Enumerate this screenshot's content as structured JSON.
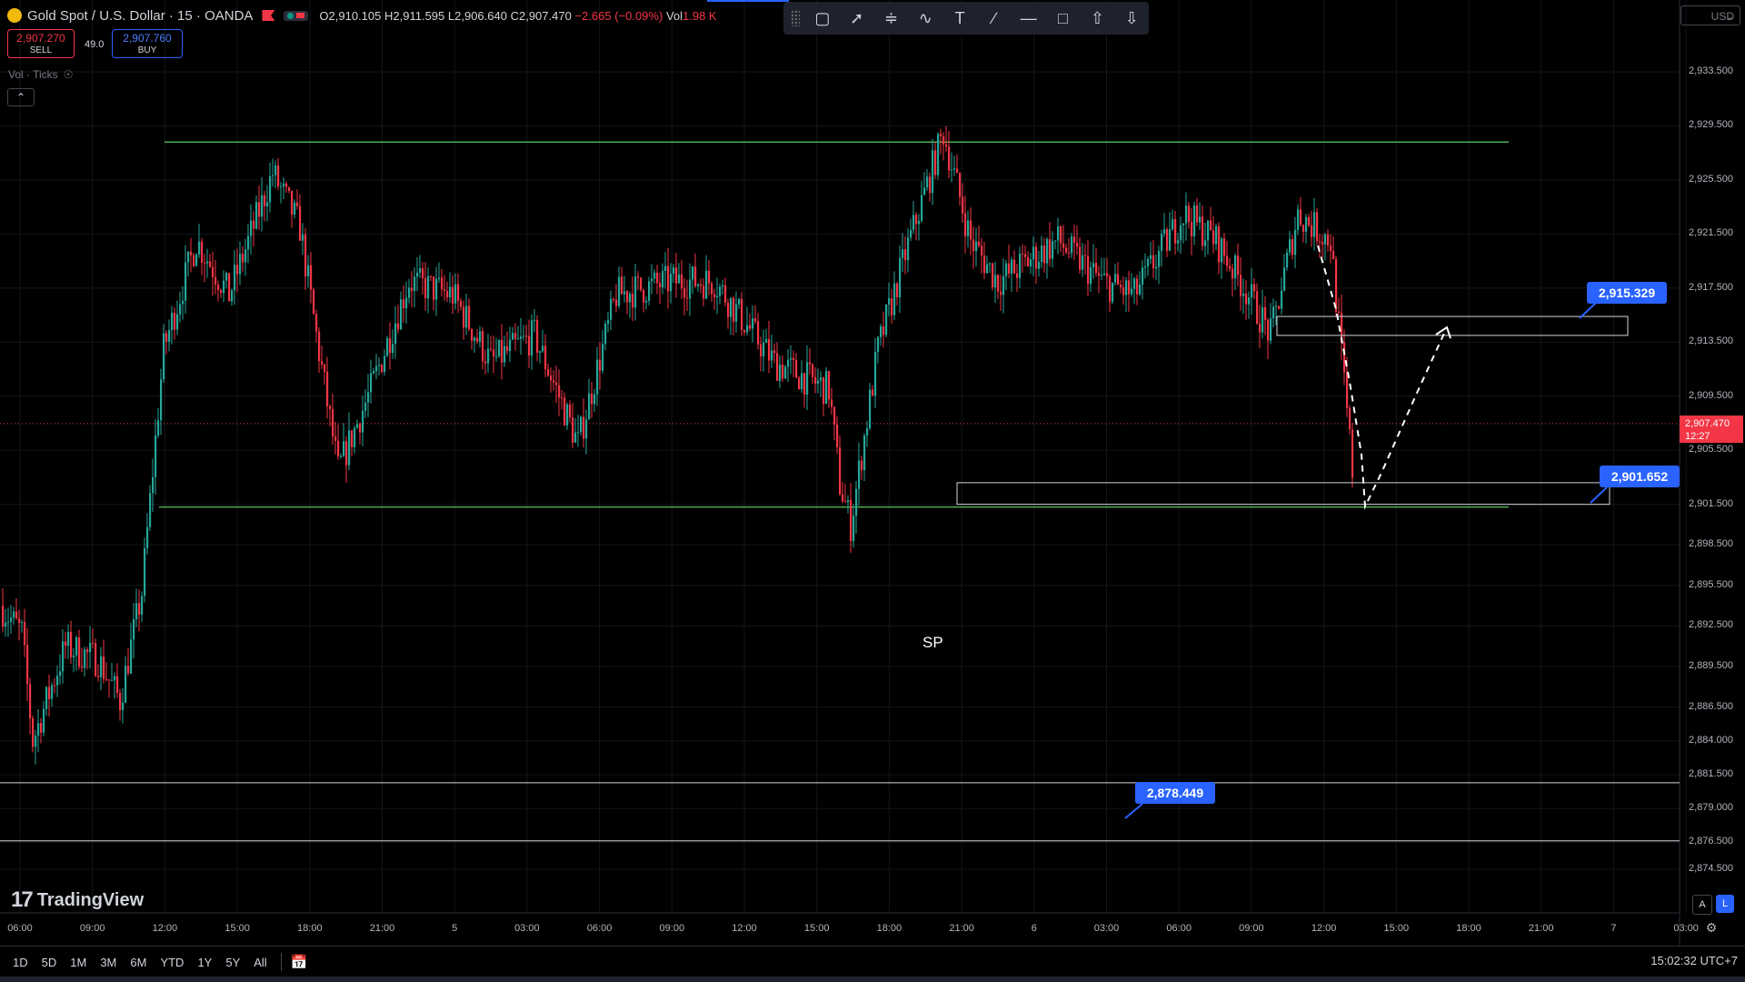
{
  "header": {
    "symbol": "Gold Spot / U.S. Dollar · 15 · OANDA",
    "open": "O2,910.105",
    "high": "H2,911.595",
    "low": "L2,906.640",
    "close": "C2,907.470",
    "change": "−2.665 (−0.09%)",
    "vol_label": "Vol",
    "vol_value": "1.98 K"
  },
  "trade": {
    "sell_price": "2,907.270",
    "sell_label": "SELL",
    "spread": "49.0",
    "buy_price": "2,907.760",
    "buy_label": "BUY"
  },
  "indicator": {
    "label": "Vol · Ticks"
  },
  "toolbar": {
    "tools": [
      "rectangle-icon",
      "trend-line-icon",
      "fib-icon",
      "path-icon",
      "text-icon",
      "ray-icon",
      "horizontal-line-icon",
      "callout-icon",
      "arrow-up-icon",
      "arrow-down-icon"
    ],
    "text_tool": "T"
  },
  "currency": {
    "label": "USD",
    "caret": "⌄"
  },
  "watermark": {
    "text": "TradingView",
    "mark": "17"
  },
  "annotations": {
    "sp": "SP",
    "levels": [
      "2,915.329",
      "2,901.652",
      "2,878.449"
    ]
  },
  "current_price": {
    "price": "2,907.470",
    "countdown": "12:27"
  },
  "price_axis": [
    "2,933.500",
    "2,929.500",
    "2,925.500",
    "2,921.500",
    "2,917.500",
    "2,913.500",
    "2,909.500",
    "2,905.500",
    "2,901.500",
    "2,898.500",
    "2,895.500",
    "2,892.500",
    "2,889.500",
    "2,886.500",
    "2,884.000",
    "2,881.500",
    "2,879.000",
    "2,876.500",
    "2,874.500"
  ],
  "time_axis": [
    "06:00",
    "09:00",
    "12:00",
    "15:00",
    "18:00",
    "21:00",
    "5",
    "03:00",
    "06:00",
    "09:00",
    "12:00",
    "15:00",
    "18:00",
    "21:00",
    "6",
    "03:00",
    "06:00",
    "09:00",
    "12:00",
    "15:00",
    "18:00",
    "21:00",
    "7",
    "03:00"
  ],
  "axis_badges": {
    "a": "A",
    "l": "L"
  },
  "bottom": {
    "timeframes": [
      "1D",
      "5D",
      "1M",
      "3M",
      "6M",
      "YTD",
      "1Y",
      "5Y",
      "All"
    ],
    "clock": "15:02:32 UTC+7"
  },
  "colors": {
    "up": "#26a69a",
    "down": "#f23645",
    "accent": "#2962ff",
    "support": "#4caf50"
  },
  "chart_data": {
    "type": "candlestick",
    "symbol": "Gold Spot / U.S. Dollar",
    "interval": "15",
    "ylim": [
      2873.5,
      2935.5
    ],
    "current_price": 2907.47,
    "horizontal_levels": [
      2928.3,
      2901.3,
      2880.9,
      2876.6
    ],
    "zones": [
      {
        "low": 2914.0,
        "high": 2915.4
      },
      {
        "low": 2901.5,
        "high": 2903.1
      }
    ],
    "labels": [
      2915.329,
      2901.652,
      2878.449
    ]
  }
}
